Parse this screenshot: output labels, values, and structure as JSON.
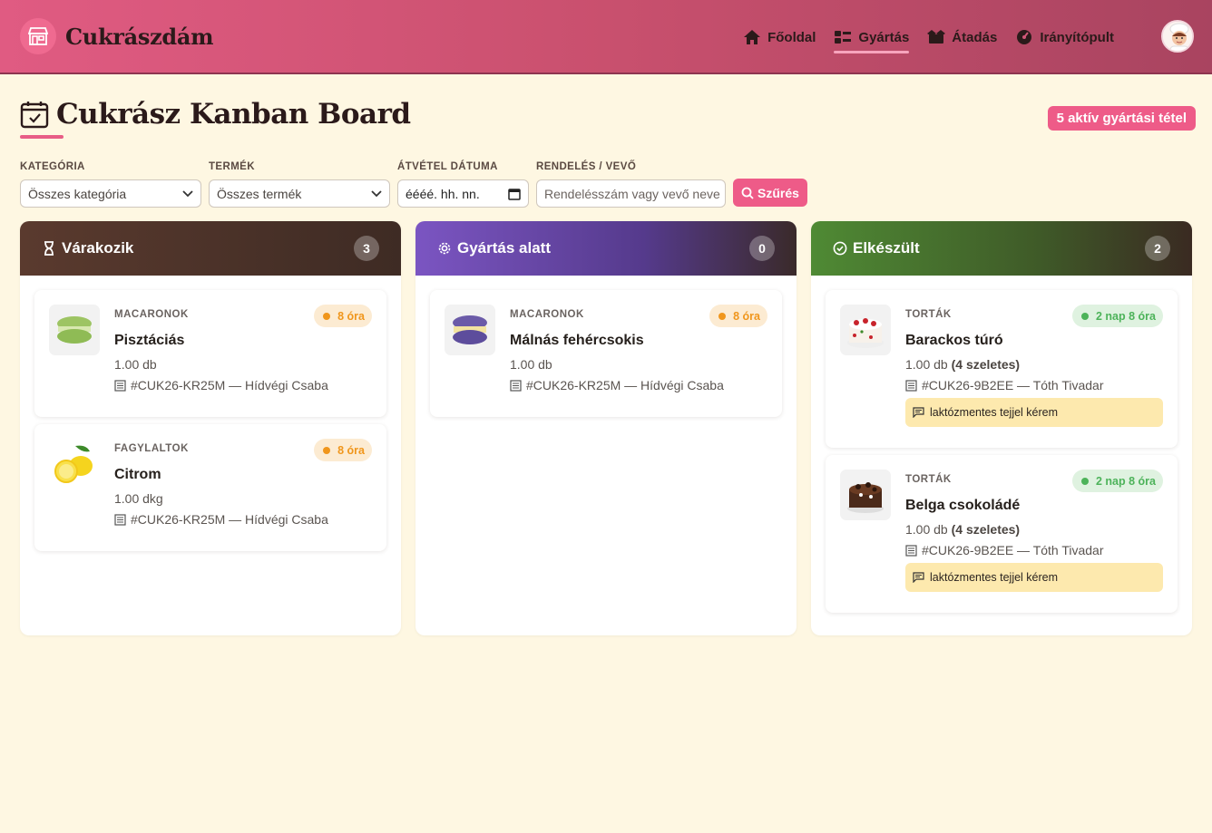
{
  "header": {
    "brand": "Cukrászdám",
    "nav": [
      {
        "label": "Főoldal",
        "icon": "home-icon"
      },
      {
        "label": "Gyártás",
        "icon": "production-icon",
        "active": true
      },
      {
        "label": "Átadás",
        "icon": "handover-icon"
      },
      {
        "label": "Irányítópult",
        "icon": "dashboard-icon"
      }
    ],
    "avatar": "chef-avatar"
  },
  "page": {
    "title": "Cukrász Kanban Board",
    "active_badge": "5 aktív gyártási tétel"
  },
  "filters": {
    "category": {
      "label": "KATEGÓRIA",
      "value": "Összes kategória"
    },
    "product": {
      "label": "TERMÉK",
      "value": "Összes termék"
    },
    "date": {
      "label": "ÁTVÉTEL DÁTUMA",
      "value": "éééé. hh. nn."
    },
    "order": {
      "label": "RENDELÉS / VEVŐ",
      "placeholder": "Rendelésszám vagy vevő neve"
    },
    "submit": "Szűrés"
  },
  "colors": {
    "accent": "#ee5b88",
    "waiting": "#5b3b2f",
    "in_progress": "#7b55c2",
    "done": "#4f8a34"
  },
  "columns": [
    {
      "title": "Várakozik",
      "icon": "hourglass-icon",
      "count": "3",
      "cards": [
        {
          "category": "MACARONOK",
          "name": "Pisztáciás",
          "qty": "1.00 db",
          "qty_extra": "",
          "order": "#CUK26-KR25M — Hídvégi Csaba",
          "time": "8 óra",
          "status": "warn",
          "thumb": "green-macaron-image",
          "note": ""
        },
        {
          "category": "FAGYLALTOK",
          "name": "Citrom",
          "qty": "1.00 dkg",
          "qty_extra": "",
          "order": "#CUK26-KR25M — Hídvégi Csaba",
          "time": "8 óra",
          "status": "warn",
          "thumb": "lemon-image",
          "note": ""
        }
      ]
    },
    {
      "title": "Gyártás alatt",
      "icon": "gear-icon",
      "count": "0",
      "cards": [
        {
          "category": "MACARONOK",
          "name": "Málnás fehércsokis",
          "qty": "1.00 db",
          "qty_extra": "",
          "order": "#CUK26-KR25M — Hídvégi Csaba",
          "time": "8 óra",
          "status": "warn",
          "thumb": "purple-macaron-image",
          "note": ""
        }
      ]
    },
    {
      "title": "Elkészült",
      "icon": "check-circle-icon",
      "count": "2",
      "cards": [
        {
          "category": "TORTÁK",
          "name": "Barackos túró",
          "qty": "1.00 db",
          "qty_extra": "(4 szeletes)",
          "order": "#CUK26-9B2EE — Tóth Tivadar",
          "time": "2 nap 8 óra",
          "status": "ok",
          "thumb": "cream-cake-image",
          "note": "laktózmentes tejjel kérem"
        },
        {
          "category": "TORTÁK",
          "name": "Belga csokoládé",
          "qty": "1.00 db",
          "qty_extra": "(4 szeletes)",
          "order": "#CUK26-9B2EE — Tóth Tivadar",
          "time": "2 nap 8 óra",
          "status": "ok",
          "thumb": "chocolate-cake-image",
          "note": "laktózmentes tejjel kérem"
        }
      ]
    }
  ]
}
